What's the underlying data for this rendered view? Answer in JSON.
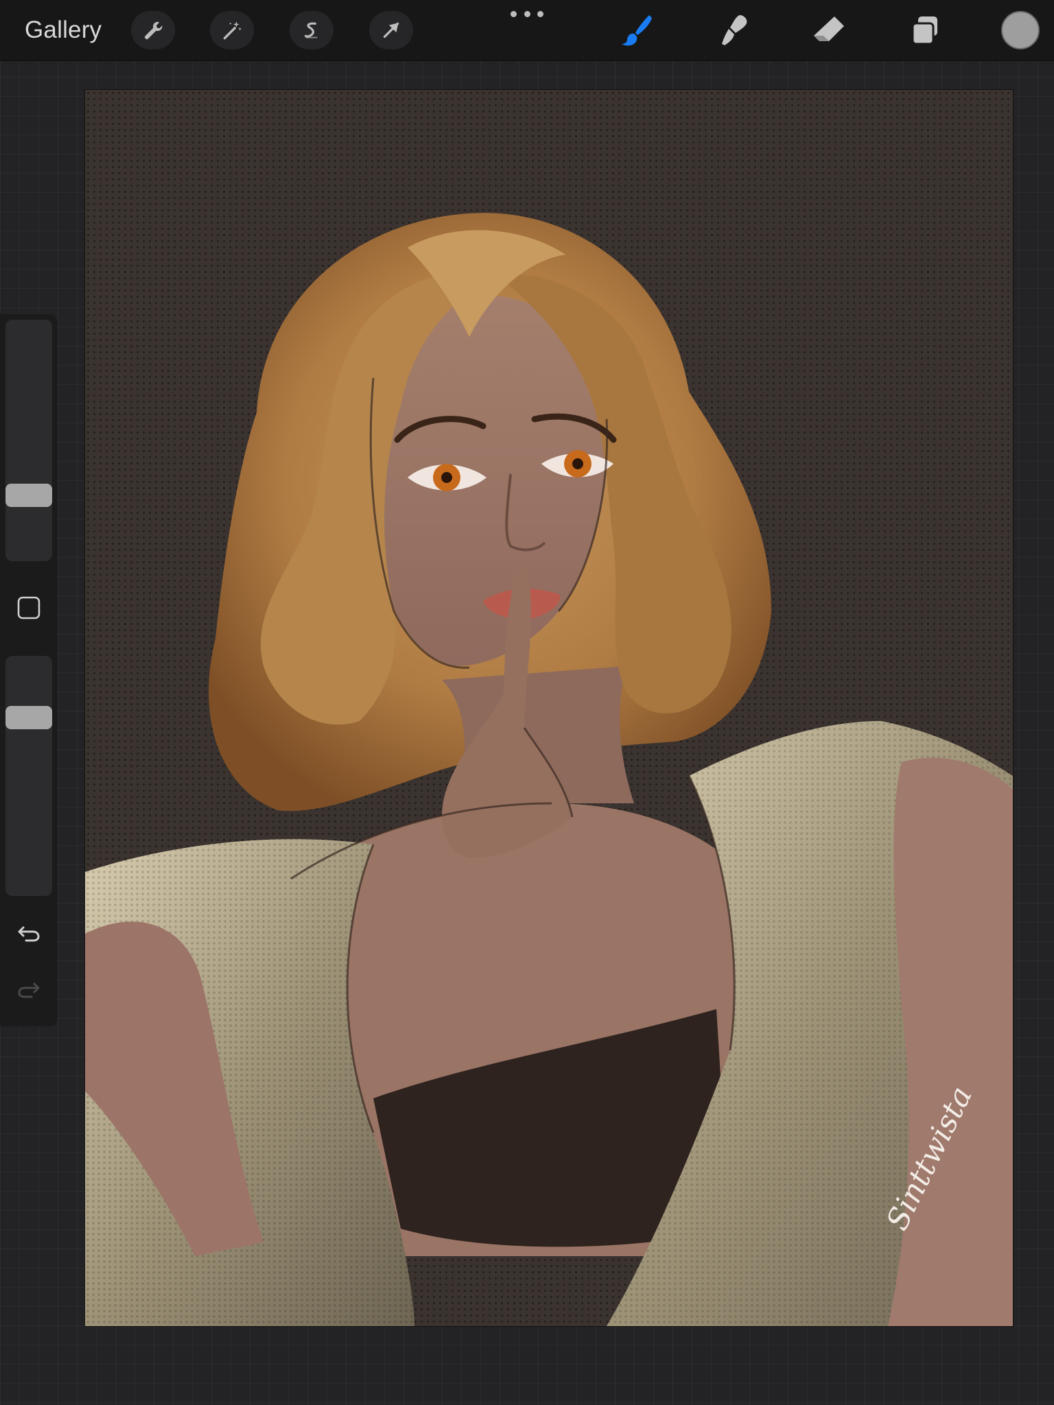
{
  "toolbar": {
    "gallery_label": "Gallery",
    "left_tools": [
      {
        "icon": "wrench-icon",
        "name": "Actions"
      },
      {
        "icon": "magic-wand-icon",
        "name": "Adjustments"
      },
      {
        "icon": "selection-icon",
        "name": "Selection"
      },
      {
        "icon": "arrow-cursor-icon",
        "name": "Transform"
      }
    ],
    "right_tools": [
      {
        "icon": "brush-icon",
        "name": "Paint",
        "active": true
      },
      {
        "icon": "smudge-icon",
        "name": "Smudge",
        "active": false
      },
      {
        "icon": "eraser-icon",
        "name": "Erase",
        "active": false
      },
      {
        "icon": "layers-icon",
        "name": "Layers",
        "active": false
      }
    ],
    "current_color": "#9e9e9e",
    "accent_color": "#1a7cf5"
  },
  "sidebar": {
    "brush_size_level": 0.25,
    "brush_opacity_level": 0.77,
    "icons": [
      "modify-square-icon",
      "undo-icon",
      "redo-icon"
    ]
  },
  "canvas": {
    "background_color": "#3b332f",
    "signature_text": "Sinttwista"
  }
}
